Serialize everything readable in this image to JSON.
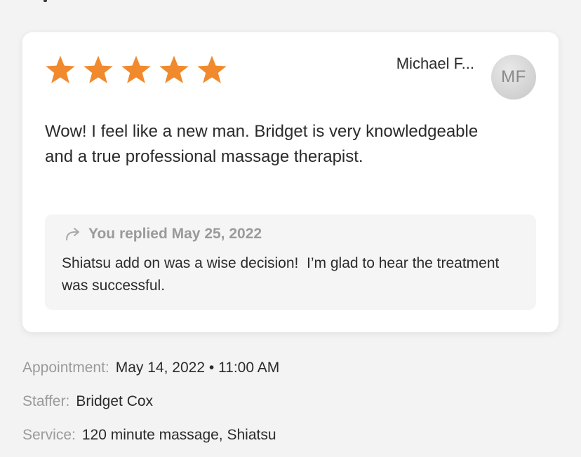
{
  "review": {
    "rating": 5,
    "max_rating": 5,
    "star_color": "#f08a2c",
    "reviewer_name": "Michael F...",
    "avatar_initials": "MF",
    "text": "Wow! I feel like a new man. Bridget is very knowledgeable and a true professional massage therapist."
  },
  "reply": {
    "icon": "reply-arrow-icon",
    "header": "You replied May 25, 2022",
    "text": "Shiatsu add on was a wise decision!  I’m glad to hear the treatment was successful."
  },
  "details": {
    "appointment_label": "Appointment:",
    "appointment_value": "May 14, 2022 • 11:00 AM",
    "staffer_label": "Staffer:",
    "staffer_value": "Bridget Cox",
    "service_label": "Service:",
    "service_value": "120 minute massage, Shiatsu"
  }
}
